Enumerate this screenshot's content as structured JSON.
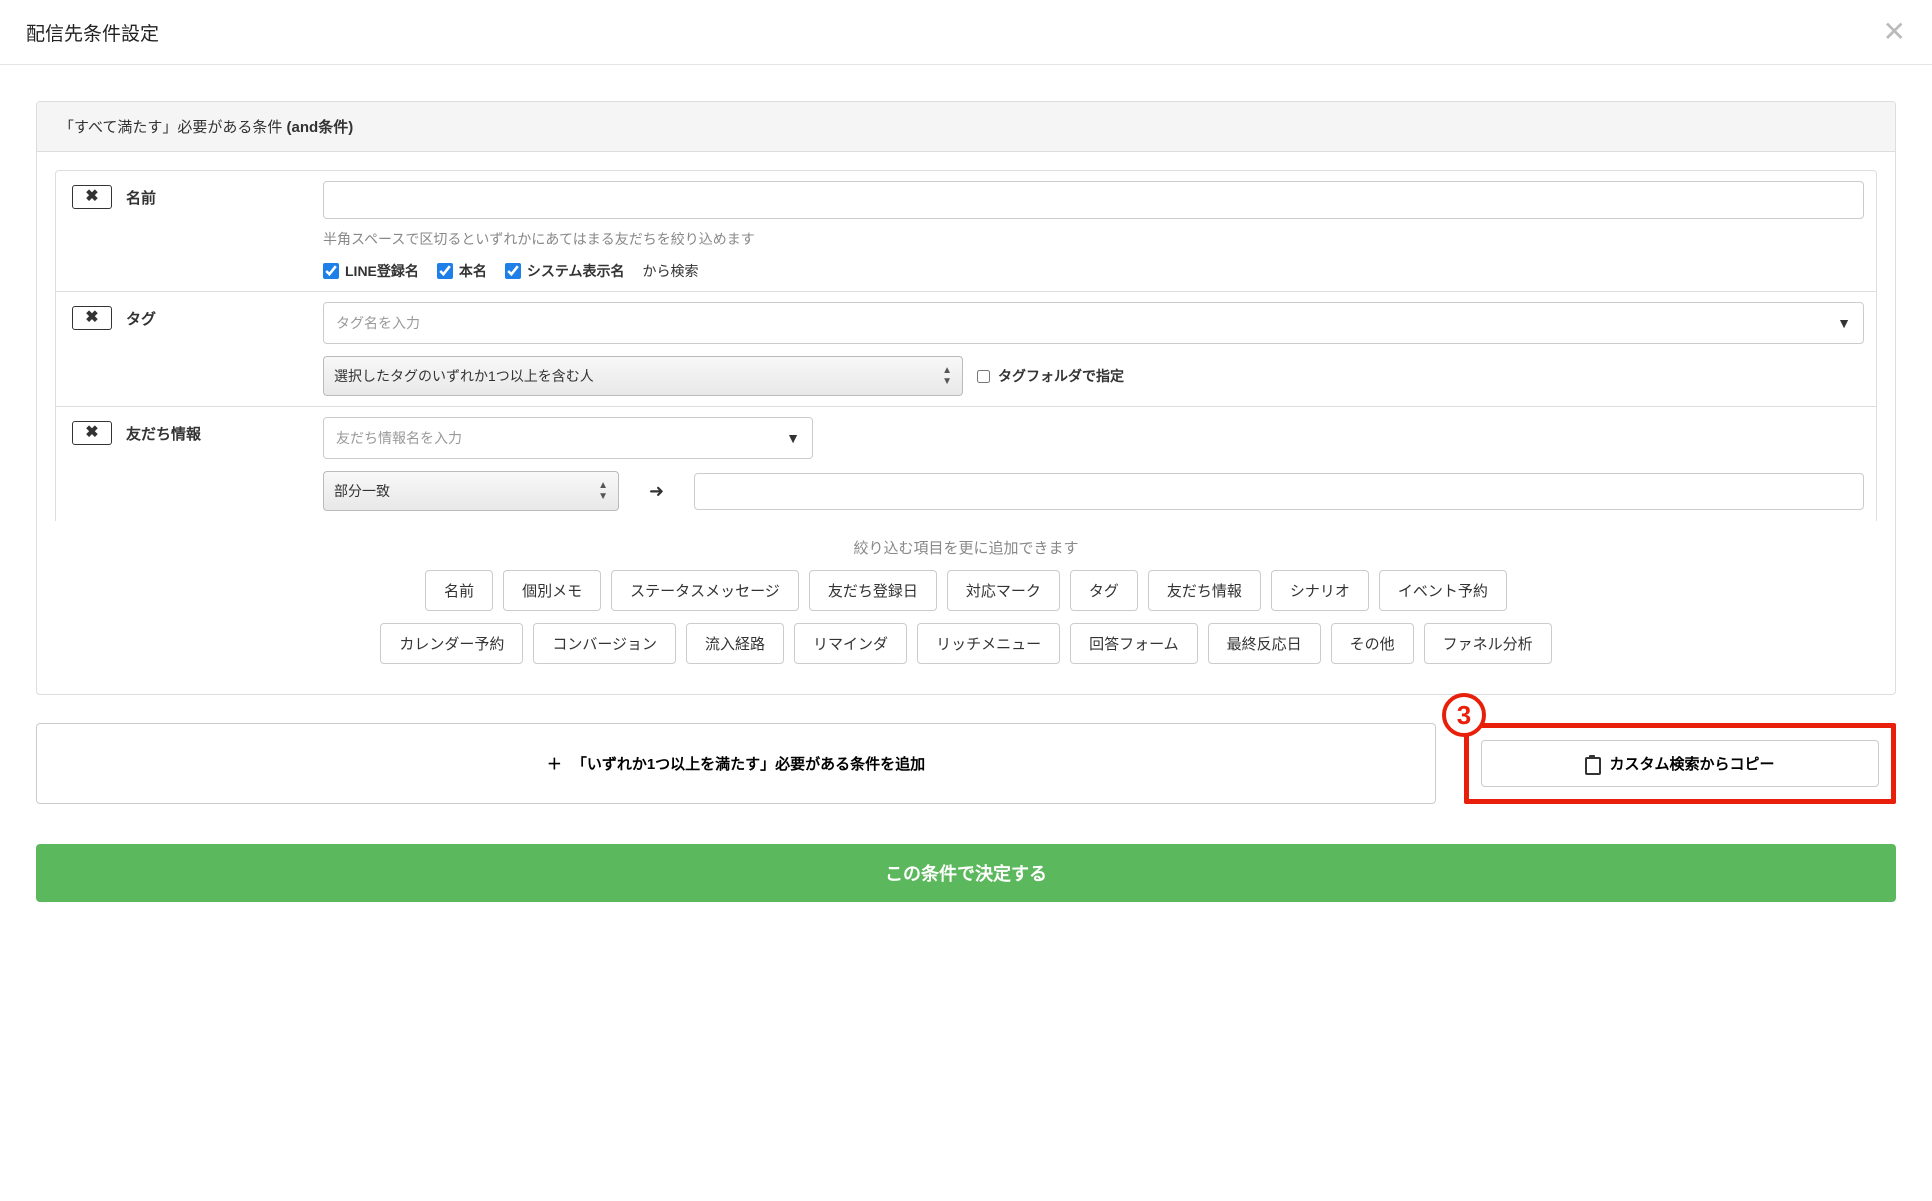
{
  "modal": {
    "title": "配信先条件設定"
  },
  "panel": {
    "header_prefix": "「すべて満たす」必要がある条件 ",
    "header_strong": "(and条件)"
  },
  "conditions": {
    "name": {
      "label": "名前",
      "value": "",
      "hint": "半角スペースで区切るといずれかにあてはまる友だちを絞り込めます",
      "cb_line": "LINE登録名",
      "cb_real": "本名",
      "cb_system": "システム表示名",
      "search_from": "から検索"
    },
    "tag": {
      "label": "タグ",
      "placeholder": "タグ名を入力",
      "select": "選択したタグのいずれか1つ以上を含む人",
      "folder_label": "タグフォルダで指定"
    },
    "friend": {
      "label": "友だち情報",
      "placeholder": "友だち情報名を入力",
      "match_select": "部分一致",
      "value": ""
    }
  },
  "add_hint": "絞り込む項目を更に追加できます",
  "filters": {
    "row1": [
      "名前",
      "個別メモ",
      "ステータスメッセージ",
      "友だち登録日",
      "対応マーク",
      "タグ",
      "友だち情報",
      "シナリオ",
      "イベント予約"
    ],
    "row2": [
      "カレンダー予約",
      "コンバージョン",
      "流入経路",
      "リマインダ",
      "リッチメニュー",
      "回答フォーム",
      "最終反応日",
      "その他",
      "ファネル分析"
    ]
  },
  "annotation": "3",
  "buttons": {
    "add_or": "「いずれか1つ以上を満たす」必要がある条件を追加",
    "copy": "カスタム検索からコピー",
    "confirm": "この条件で決定する"
  }
}
